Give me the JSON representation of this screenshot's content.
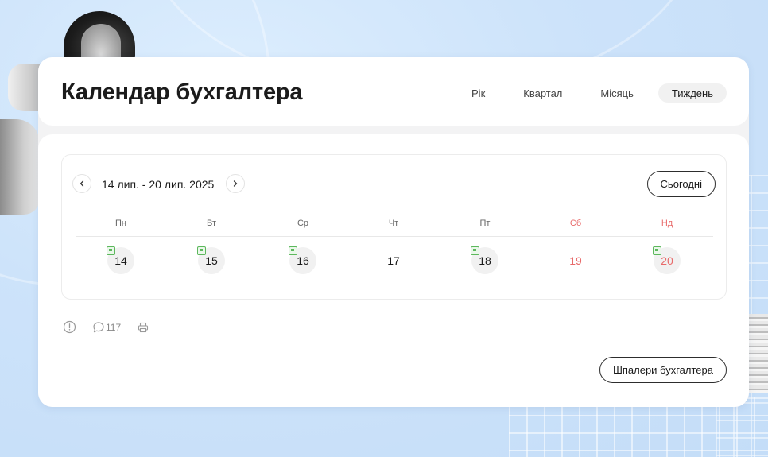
{
  "header": {
    "title": "Календар бухгалтера",
    "tabs": [
      {
        "label": "Рік",
        "active": false
      },
      {
        "label": "Квартал",
        "active": false
      },
      {
        "label": "Місяць",
        "active": false
      },
      {
        "label": "Тиждень",
        "active": true
      }
    ]
  },
  "calendar": {
    "prev_icon": "chevron-left-icon",
    "next_icon": "chevron-right-icon",
    "range_label": "14 лип. - 20 лип. 2025",
    "today_label": "Сьогодні",
    "weekdays": [
      {
        "label": "Пн",
        "weekend": false
      },
      {
        "label": "Вт",
        "weekend": false
      },
      {
        "label": "Ср",
        "weekend": false
      },
      {
        "label": "Чт",
        "weekend": false
      },
      {
        "label": "Пт",
        "weekend": false
      },
      {
        "label": "Сб",
        "weekend": true
      },
      {
        "label": "Нд",
        "weekend": true
      }
    ],
    "days": [
      {
        "num": "14",
        "has_event": true,
        "weekend": false
      },
      {
        "num": "15",
        "has_event": true,
        "weekend": false
      },
      {
        "num": "16",
        "has_event": true,
        "weekend": false
      },
      {
        "num": "17",
        "has_event": false,
        "weekend": false
      },
      {
        "num": "18",
        "has_event": true,
        "weekend": false
      },
      {
        "num": "19",
        "has_event": false,
        "weekend": true
      },
      {
        "num": "20",
        "has_event": true,
        "weekend": true
      }
    ],
    "event_icon": "note-icon",
    "event_color": "#5cb85c",
    "weekend_color": "#e86a6a"
  },
  "meta": {
    "info_icon": "info-icon",
    "comment_icon": "comment-icon",
    "comment_count": "117",
    "print_icon": "print-icon"
  },
  "footer": {
    "wallpaper_label": "Шпалери бухгалтера"
  }
}
